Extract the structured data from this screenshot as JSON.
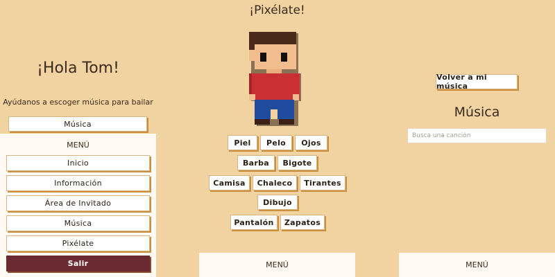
{
  "left_panel": {
    "greeting": "¡Hola Tom!",
    "subtitle": "Ayúdanos a escoger música para bailar",
    "music_button": "Música",
    "menu": {
      "title": "MENÚ",
      "items": [
        {
          "label": "Inicio"
        },
        {
          "label": "Información"
        },
        {
          "label": "Área de Invitado"
        },
        {
          "label": "Música"
        },
        {
          "label": "Pixélate"
        },
        {
          "label": "Salir"
        }
      ]
    }
  },
  "center_panel": {
    "title": "¡Pixélate!",
    "options": {
      "piel": "Piel",
      "pelo": "Pelo",
      "ojos": "Ojos",
      "barba": "Barba",
      "bigote": "Bigote",
      "camisa": "Camisa",
      "chaleco": "Chaleco",
      "tirantes": "Tirantes",
      "dibujo": "Dibujo",
      "pantalon": "Pantalón",
      "zapatos": "Zapatos"
    },
    "footer": "MENÚ"
  },
  "right_panel": {
    "back_button": "Volver a mi música",
    "title": "Música",
    "search_placeholder": "Busca una canción",
    "footer": "MENÚ"
  },
  "colors": {
    "background": "#f1d3a2",
    "panel": "#fffaf4",
    "button_shadow": "#c98f3c",
    "exit_button": "#6b2a32",
    "avatar_hair": "#4a2a1a",
    "avatar_skin": "#f2bd8e",
    "avatar_shirt": "#c93034",
    "avatar_pants": "#1f4c9e"
  }
}
